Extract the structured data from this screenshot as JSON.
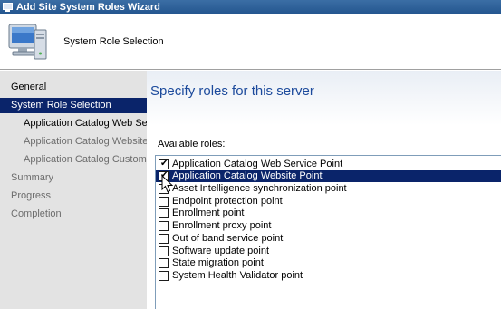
{
  "window": {
    "title": "Add Site System Roles Wizard"
  },
  "header": {
    "step_title": "System Role Selection"
  },
  "sidebar": {
    "items": [
      {
        "label": "General"
      },
      {
        "label": "System Role Selection"
      },
      {
        "label": "Application Catalog Web Se"
      },
      {
        "label": "Application Catalog Website"
      },
      {
        "label": "Application Catalog Customi"
      },
      {
        "label": "Summary"
      },
      {
        "label": "Progress"
      },
      {
        "label": "Completion"
      }
    ]
  },
  "main": {
    "heading": "Specify roles for this server",
    "available_roles_label": "Available roles:",
    "roles": [
      {
        "label": "Application Catalog Web Service Point",
        "checked": true
      },
      {
        "label": "Application Catalog Website Point",
        "checked": true
      },
      {
        "label": "Asset Intelligence synchronization point",
        "checked": false
      },
      {
        "label": "Endpoint protection point",
        "checked": false
      },
      {
        "label": "Enrollment point",
        "checked": false
      },
      {
        "label": "Enrollment proxy point",
        "checked": false
      },
      {
        "label": "Out of band service point",
        "checked": false
      },
      {
        "label": "Software update point",
        "checked": false
      },
      {
        "label": "State migration point",
        "checked": false
      },
      {
        "label": "System Health Validator point",
        "checked": false
      }
    ]
  },
  "colors": {
    "selection": "#0a246a",
    "heading": "#1c4a9c",
    "sidebar_bg": "#e3e3e3"
  }
}
